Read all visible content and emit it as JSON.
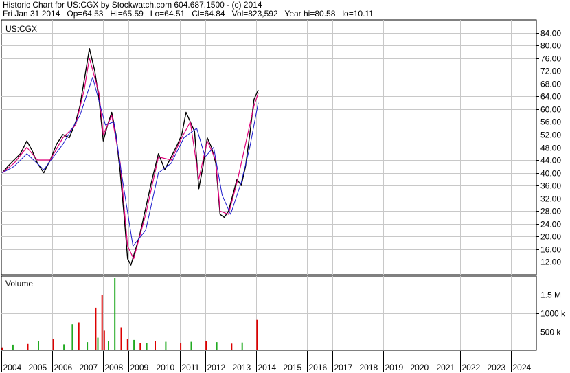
{
  "header": {
    "title": "Historic Chart for US:CGX by Stockwatch.com 604.687.1500 - (c) 2014",
    "quote": "Fri Jan 31 2014   Op=64.53   Hi=65.59   Lo=64.51   Cl=64.84   Vol=823,592   Year hi=80.58   lo=10.11"
  },
  "colors": {
    "price": "#000000",
    "ma_fast": "#e0007a",
    "ma_slow": "#1a1acc",
    "volume_up": "#22aa22",
    "volume_down": "#dd0000",
    "grid": "#c8c8c8"
  },
  "chart_data": [
    {
      "type": "line",
      "title": "US:CGX",
      "xlabel": "",
      "ylabel": "",
      "xlim": [
        "2004-01-01",
        "2024-12-31"
      ],
      "ylim": [
        8,
        88
      ],
      "y_ticks": [
        "12.00",
        "16.00",
        "20.00",
        "24.00",
        "28.00",
        "32.00",
        "36.00",
        "40.00",
        "44.00",
        "48.00",
        "52.00",
        "56.00",
        "60.00",
        "64.00",
        "68.00",
        "72.00",
        "76.00",
        "80.00",
        "84.00"
      ],
      "x_ticks": [
        "2004",
        "2005",
        "2006",
        "2007",
        "2008",
        "2009",
        "2010",
        "2011",
        "2012",
        "2013",
        "2014",
        "2015",
        "2016",
        "2017",
        "2018",
        "2019",
        "2020",
        "2021",
        "2022",
        "2023",
        "2024"
      ],
      "grid": true,
      "series": [
        {
          "key": "price",
          "x": [
            "2004-01-15",
            "2004-04-01",
            "2004-07-01",
            "2004-10-01",
            "2005-01-01",
            "2005-03-15",
            "2005-06-01",
            "2005-09-01",
            "2005-12-01",
            "2006-03-01",
            "2006-06-01",
            "2006-09-01",
            "2006-12-01",
            "2007-02-01",
            "2007-04-01",
            "2007-06-15",
            "2007-09-01",
            "2007-11-01",
            "2008-01-01",
            "2008-03-01",
            "2008-05-01",
            "2008-07-01",
            "2008-09-01",
            "2008-11-01",
            "2008-12-15",
            "2009-02-01",
            "2009-03-10",
            "2009-06-01",
            "2009-09-01",
            "2009-12-01",
            "2010-03-01",
            "2010-06-01",
            "2010-09-01",
            "2010-12-01",
            "2011-02-01",
            "2011-04-01",
            "2011-06-01",
            "2011-08-01",
            "2011-10-01",
            "2011-12-01",
            "2012-02-01",
            "2012-04-01",
            "2012-06-01",
            "2012-08-01",
            "2012-10-01",
            "2012-12-01",
            "2013-02-01",
            "2013-04-01",
            "2013-06-01",
            "2013-08-01",
            "2013-10-01",
            "2013-12-01",
            "2014-01-31"
          ],
          "values": [
            40,
            42,
            44,
            46,
            50,
            47,
            43,
            40,
            44,
            49,
            52,
            51,
            56,
            61,
            69,
            79,
            72,
            63,
            50,
            55,
            59,
            52,
            40,
            25,
            13,
            11,
            14,
            20,
            29,
            38,
            46,
            41,
            45,
            49,
            52,
            59,
            56,
            53,
            35,
            42,
            51,
            48,
            43,
            27,
            26,
            28,
            33,
            38,
            36,
            42,
            52,
            63,
            66
          ]
        },
        {
          "key": "ma_fast",
          "x": [
            "2004-01-15",
            "2004-07-01",
            "2005-01-01",
            "2005-06-01",
            "2005-12-01",
            "2006-06-01",
            "2006-12-01",
            "2007-04-01",
            "2007-06-15",
            "2007-11-01",
            "2008-01-01",
            "2008-05-01",
            "2008-09-01",
            "2008-12-15",
            "2009-03-10",
            "2009-09-01",
            "2010-03-01",
            "2010-09-01",
            "2011-02-01",
            "2011-06-01",
            "2011-10-01",
            "2012-02-01",
            "2012-06-01",
            "2012-08-01",
            "2012-12-01",
            "2013-04-01",
            "2013-08-01",
            "2013-12-01",
            "2014-01-31"
          ],
          "values": [
            40,
            43,
            48,
            44,
            44,
            51,
            55,
            66,
            76,
            65,
            52,
            58,
            43,
            17,
            13,
            27,
            45,
            44,
            51,
            56,
            38,
            50,
            44,
            28,
            27,
            37,
            49,
            61,
            65
          ]
        },
        {
          "key": "ma_slow",
          "x": [
            "2004-01-15",
            "2004-07-01",
            "2005-01-01",
            "2005-09-01",
            "2006-06-01",
            "2007-02-01",
            "2007-08-01",
            "2008-02-01",
            "2008-06-01",
            "2008-10-01",
            "2009-03-01",
            "2009-09-01",
            "2010-03-01",
            "2010-09-01",
            "2011-03-01",
            "2011-09-01",
            "2012-01-01",
            "2012-05-01",
            "2012-09-01",
            "2013-01-01",
            "2013-06-01",
            "2013-10-01",
            "2014-01-31"
          ],
          "values": [
            40,
            42,
            46,
            41,
            49,
            58,
            70,
            55,
            56,
            38,
            17,
            22,
            40,
            43,
            51,
            54,
            45,
            48,
            33,
            27,
            37,
            48,
            62
          ]
        }
      ]
    },
    {
      "type": "bar",
      "title": "Volume",
      "xlim": [
        "2004-01-01",
        "2024-12-31"
      ],
      "ylim": [
        0,
        2000000
      ],
      "y_ticks": [
        "500 k",
        "1000 k",
        "1.5 M"
      ],
      "series": [
        {
          "key": "volume",
          "x": [
            "2004-01",
            "2004-06",
            "2005-01",
            "2005-06",
            "2006-01",
            "2006-06",
            "2006-10",
            "2007-01",
            "2007-05",
            "2007-09",
            "2007-10",
            "2007-12",
            "2008-01",
            "2008-03",
            "2008-06",
            "2008-09",
            "2008-12",
            "2009-03",
            "2009-06",
            "2009-09",
            "2010-01",
            "2010-06",
            "2011-01",
            "2011-06",
            "2012-01",
            "2012-06",
            "2013-01",
            "2013-06",
            "2014-01"
          ],
          "values": [
            80000,
            150000,
            170000,
            250000,
            300000,
            160000,
            700000,
            750000,
            220000,
            1150000,
            340000,
            1500000,
            530000,
            240000,
            1950000,
            620000,
            300000,
            280000,
            200000,
            190000,
            250000,
            230000,
            200000,
            230000,
            260000,
            220000,
            180000,
            210000,
            820000
          ],
          "direction": [
            "down",
            "up",
            "down",
            "up",
            "down",
            "up",
            "up",
            "down",
            "up",
            "down",
            "up",
            "down",
            "down",
            "up",
            "up",
            "down",
            "down",
            "up",
            "down",
            "up",
            "down",
            "up",
            "down",
            "up",
            "down",
            "up",
            "down",
            "up",
            "down"
          ]
        }
      ]
    }
  ]
}
